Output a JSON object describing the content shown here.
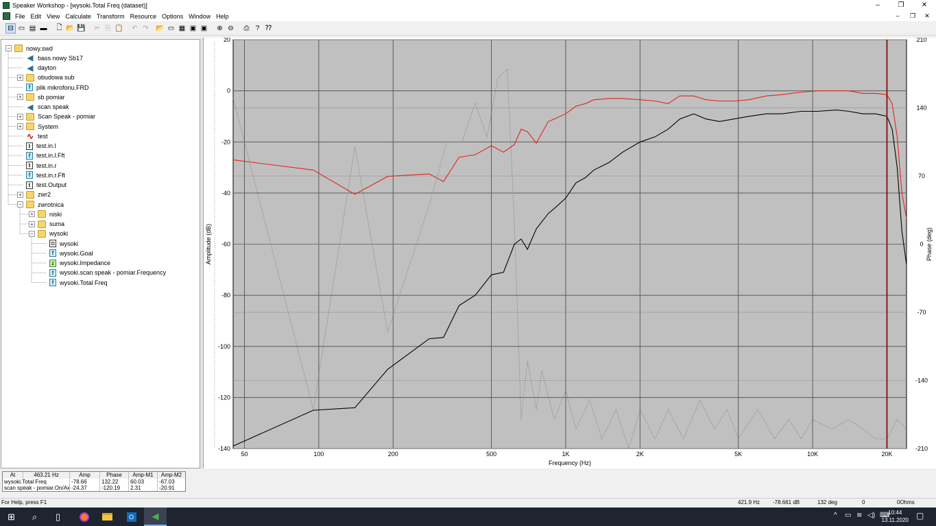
{
  "window": {
    "title": "Speaker Workshop - [wysoki.Total Freq (dataset)]",
    "controls": [
      "–",
      "❐",
      "✕"
    ],
    "mdi_controls": [
      "–",
      "❐",
      "✕"
    ]
  },
  "menu": [
    "File",
    "Edit",
    "View",
    "Calculate",
    "Transform",
    "Resource",
    "Options",
    "Window",
    "Help"
  ],
  "toolbar": [
    {
      "icon": "tree-view-icon",
      "glyph": "⊟",
      "active": true
    },
    {
      "icon": "list-icon",
      "glyph": "▭",
      "active": false
    },
    {
      "icon": "details-icon",
      "glyph": "▤",
      "active": false
    },
    {
      "icon": "small-icons-icon",
      "glyph": "▬",
      "active": false
    },
    {
      "icon": "new-file-icon",
      "glyph": "🗋",
      "active": false
    },
    {
      "icon": "open-icon",
      "glyph": "📂",
      "active": false
    },
    {
      "icon": "save-icon",
      "glyph": "💾",
      "active": false
    },
    {
      "icon": "cut-icon",
      "glyph": "✂",
      "disabled": true
    },
    {
      "icon": "copy-icon",
      "glyph": "⎘",
      "disabled": true
    },
    {
      "icon": "paste-icon",
      "glyph": "📋",
      "disabled": true
    },
    {
      "icon": "undo-icon",
      "glyph": "↶",
      "disabled": true
    },
    {
      "icon": "redo-icon",
      "glyph": "↷",
      "disabled": true
    },
    {
      "icon": "open-folder-icon",
      "glyph": "📂",
      "active": false
    },
    {
      "icon": "new-network-icon",
      "glyph": "▭",
      "active": false
    },
    {
      "icon": "new-chart-icon",
      "glyph": "▦",
      "active": false
    },
    {
      "icon": "new-dataset-icon",
      "glyph": "▣",
      "active": false
    },
    {
      "icon": "delete-icon",
      "glyph": "▣",
      "active": false
    },
    {
      "icon": "zoom-in-icon",
      "glyph": "⊕",
      "active": false
    },
    {
      "icon": "zoom-out-icon",
      "glyph": "⊖",
      "active": false
    },
    {
      "icon": "print-icon",
      "glyph": "⎙",
      "active": false
    },
    {
      "icon": "help-icon",
      "glyph": "?",
      "active": false
    },
    {
      "icon": "context-help-icon",
      "glyph": "⁇",
      "active": false
    }
  ],
  "tree": [
    {
      "label": "nowy.swd",
      "icon": "folder",
      "level": 0,
      "expander": "−"
    },
    {
      "label": "bass nowy Sb17",
      "icon": "speaker",
      "level": 1,
      "expander": ""
    },
    {
      "label": "dayton",
      "icon": "speaker",
      "level": 1,
      "expander": ""
    },
    {
      "label": "obudowa sub",
      "icon": "folder",
      "level": 1,
      "expander": "+"
    },
    {
      "label": "plik mikrofonu.FRD",
      "icon": "f",
      "level": 1,
      "expander": ""
    },
    {
      "label": "sb pomiar",
      "icon": "folder",
      "level": 1,
      "expander": "+"
    },
    {
      "label": "scan speak",
      "icon": "speaker",
      "level": 1,
      "expander": ""
    },
    {
      "label": "Scan Speak - pomiar",
      "icon": "folder",
      "level": 1,
      "expander": "+"
    },
    {
      "label": "System",
      "icon": "folder",
      "level": 1,
      "expander": "+"
    },
    {
      "label": "test",
      "icon": "wave",
      "level": 1,
      "expander": ""
    },
    {
      "label": "test.in.l",
      "icon": "doc",
      "level": 1,
      "expander": ""
    },
    {
      "label": "test.in.l.Fft",
      "icon": "f",
      "level": 1,
      "expander": ""
    },
    {
      "label": "test.in.r",
      "icon": "doc",
      "level": 1,
      "expander": ""
    },
    {
      "label": "test.in.r.Fft",
      "icon": "f",
      "level": 1,
      "expander": ""
    },
    {
      "label": "test.Output",
      "icon": "doc",
      "level": 1,
      "expander": ""
    },
    {
      "label": "zwr2",
      "icon": "folder",
      "level": 1,
      "expander": "+"
    },
    {
      "label": "zwrotnica",
      "icon": "folder",
      "level": 1,
      "expander": "−"
    },
    {
      "label": "niski",
      "icon": "folder",
      "level": 2,
      "expander": "+"
    },
    {
      "label": "suma",
      "icon": "folder",
      "level": 2,
      "expander": "+"
    },
    {
      "label": "wysoki",
      "icon": "folder",
      "level": 2,
      "expander": "−"
    },
    {
      "label": "wysoki",
      "icon": "net",
      "level": 3,
      "expander": ""
    },
    {
      "label": "wysoki.Goal",
      "icon": "f",
      "level": 3,
      "expander": ""
    },
    {
      "label": "wysoki.Impedance",
      "icon": "z",
      "level": 3,
      "expander": ""
    },
    {
      "label": "wysoki.scan speak - pomiar.Frequency",
      "icon": "f",
      "level": 3,
      "expander": ""
    },
    {
      "label": "wysoki.Total Freq",
      "icon": "f",
      "level": 3,
      "expander": ""
    }
  ],
  "colors": {
    "plot_bg": "#c0c0c0",
    "grid": "#5a5a5a",
    "series_red": "#e3231c",
    "series_black": "#000000",
    "phase_dotted": "#808080",
    "marker": "#8b1a1a"
  },
  "chart_data": {
    "type": "line",
    "xlabel": "Frequency (Hz)",
    "ylabel": "Amplitude (dB)",
    "y2label": "Phase (deg)",
    "xscale": "log",
    "xlim": [
      45,
      24000
    ],
    "ylim": [
      -140,
      20
    ],
    "y2lim": [
      -210,
      210
    ],
    "x_ticks": [
      50,
      100,
      200,
      500,
      1000,
      2000,
      5000,
      10000,
      20000
    ],
    "x_tick_labels": [
      "50",
      "100",
      "200",
      "500",
      "1K",
      "2K",
      "5K",
      "10K",
      "20K"
    ],
    "y_ticks": [
      20,
      0,
      -20,
      -40,
      -60,
      -80,
      -100,
      -120,
      -140
    ],
    "y2_ticks": [
      210,
      140,
      70,
      0,
      -70,
      -140,
      -210
    ],
    "grid": true,
    "watermark": "",
    "marker_x": 20000,
    "series": [
      {
        "color": "red",
        "x": [
          45,
          95,
          140,
          190,
          280,
          320,
          370,
          430,
          500,
          560,
          620,
          660,
          700,
          760,
          850,
          900,
          1000,
          1100,
          1200,
          1300,
          1500,
          1700,
          2000,
          2300,
          2600,
          2900,
          3300,
          3700,
          4200,
          4800,
          5500,
          6500,
          7500,
          9000,
          10500,
          12500,
          14000,
          16000,
          18000,
          20000,
          21000,
          22000,
          23000,
          24000
        ],
        "y": [
          -27,
          -31,
          -40.5,
          -33.5,
          -32.5,
          -35.5,
          -26,
          -25,
          -21.5,
          -24,
          -21,
          -15,
          -16,
          -20.5,
          -12,
          -11,
          -9,
          -6,
          -5,
          -3.5,
          -3,
          -3,
          -3.5,
          -4,
          -5,
          -2,
          -2,
          -3.5,
          -4,
          -4,
          -3.5,
          -2,
          -1.5,
          -0.5,
          0,
          0,
          0,
          -1,
          -1,
          -1.5,
          -5,
          -18,
          -40,
          -50
        ]
      },
      {
        "color": "black",
        "x": [
          45,
          95,
          140,
          190,
          280,
          320,
          370,
          430,
          500,
          560,
          620,
          660,
          700,
          760,
          850,
          900,
          1000,
          1100,
          1200,
          1300,
          1500,
          1700,
          2000,
          2300,
          2600,
          2900,
          3300,
          3700,
          4200,
          4800,
          5500,
          6500,
          7500,
          9000,
          10500,
          12500,
          14000,
          16000,
          18000,
          20000,
          21000,
          22000,
          23000,
          24000
        ],
        "y": [
          -139,
          -125,
          -124,
          -109,
          -97,
          -96.5,
          -84,
          -80,
          -72,
          -71,
          -60,
          -58,
          -62,
          -54,
          -48,
          -46,
          -42,
          -36,
          -34,
          -31,
          -28,
          -24,
          -20,
          -18,
          -15,
          -11,
          -9,
          -11,
          -12,
          -11,
          -10,
          -9,
          -9,
          -8,
          -8,
          -7.5,
          -8,
          -9,
          -9,
          -10,
          -15,
          -30,
          -55,
          -68
        ]
      },
      {
        "color": "gray-dotted",
        "axis": "phase",
        "x": [
          45,
          95,
          140,
          190,
          280,
          330,
          380,
          430,
          480,
          530,
          580,
          620,
          660,
          700,
          760,
          800,
          900,
          1000,
          1100,
          1250,
          1400,
          1600,
          1800,
          2000,
          2300,
          2600,
          3000,
          3500,
          4000,
          4500,
          5000,
          6000,
          7000,
          8000,
          9000,
          10000,
          12000,
          14000,
          16000,
          18000,
          20000,
          22000,
          24000
        ],
        "y": [
          150,
          -170,
          100,
          -90,
          40,
          105,
          105,
          145,
          110,
          170,
          180,
          20,
          -180,
          -120,
          -170,
          -130,
          -180,
          -150,
          -190,
          -160,
          -200,
          -170,
          -210,
          -170,
          -200,
          -170,
          -200,
          -160,
          -190,
          -170,
          -200,
          -170,
          -200,
          -180,
          -200,
          -180,
          -190,
          -180,
          -190,
          -200,
          -200,
          -180,
          -190
        ]
      }
    ]
  },
  "cursor_panel": {
    "headers": [
      "At",
      "463.21 Hz",
      "Amp",
      "Phase",
      "Amp-M1",
      "Amp-M2"
    ],
    "rows": [
      [
        "wysoki.Total Freq",
        "-78.66",
        "132.22",
        "60.03",
        "-67.03"
      ],
      [
        "scan speak - pomiar.On/Axi",
        "-24.37",
        "-120.19",
        "2.31",
        "-20.91"
      ]
    ]
  },
  "statusbar": {
    "help": "For Help, press F1",
    "freq": "421.9 Hz",
    "amp": "-78.661 dB",
    "phase": "132 deg",
    "val": "0",
    "ohms": "0Ohms"
  },
  "taskbar": {
    "time": "10:44",
    "date": "13.11.2020"
  }
}
